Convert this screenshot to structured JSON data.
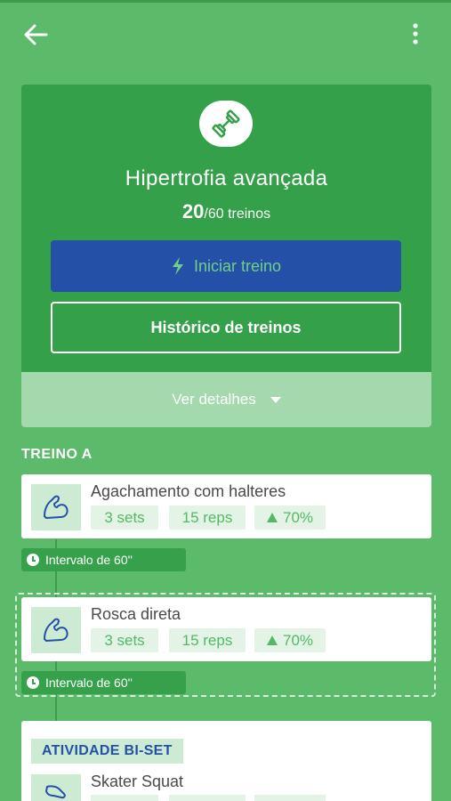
{
  "header": {
    "back_icon": "arrow-left-icon",
    "menu_icon": "more-vertical-icon"
  },
  "program": {
    "icon": "dumbbell-icon",
    "title": "Hipertrofia avançada",
    "completed": "20",
    "total_label": "/60 treinos",
    "start_label": "Iniciar treino",
    "start_icon": "bolt-icon",
    "history_label": "Histórico de treinos",
    "details_label": "Ver detalhes"
  },
  "section": {
    "title": "TREINO A"
  },
  "exercises": [
    {
      "name": "Agachamento com halteres",
      "sets": "3 sets",
      "reps": "15 reps",
      "load": "70%",
      "rest": "Intervalo de 60''"
    },
    {
      "name": "Rosca direta",
      "sets": "3 sets",
      "reps": "15 reps",
      "load": "70%",
      "rest": "Intervalo de 60''"
    }
  ],
  "biset": {
    "badge": "ATIVIDADE BI-SET",
    "exercise_name": "Skater Squat"
  },
  "colors": {
    "background": "#5cbb6b",
    "hero": "#34a049",
    "primary_button": "#2450a8",
    "chip": "#e3f4e6"
  }
}
